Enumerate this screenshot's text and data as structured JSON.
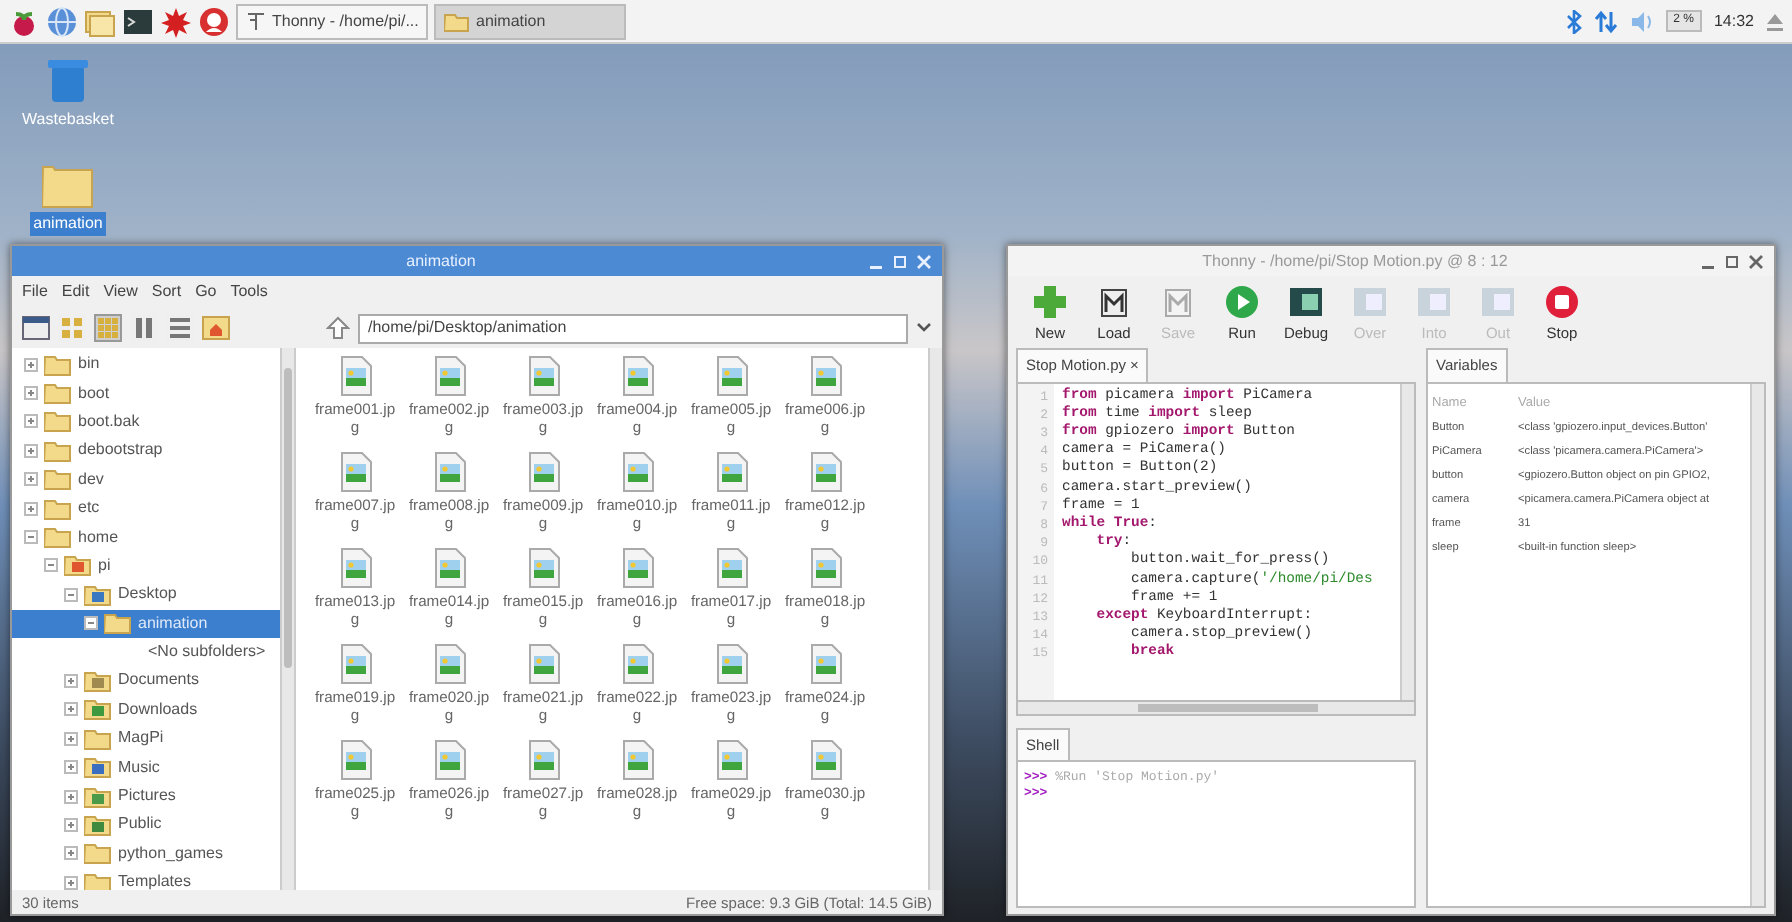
{
  "taskbar": {
    "tasks": [
      {
        "label": "Thonny - /home/pi/...",
        "kind": "thonny",
        "selected": false
      },
      {
        "label": "animation",
        "kind": "folder",
        "selected": true
      }
    ],
    "cpu": "2 %",
    "clock": "14:32"
  },
  "desktop_icons": [
    {
      "label": "Wastebasket",
      "kind": "trash",
      "selected": false
    },
    {
      "label": "animation",
      "kind": "folder",
      "selected": true
    }
  ],
  "file_manager": {
    "title": "animation",
    "menu": [
      "File",
      "Edit",
      "View",
      "Sort",
      "Go",
      "Tools"
    ],
    "view_modes": [
      {
        "selected": false
      },
      {
        "selected": true
      },
      {
        "selected": false
      },
      {
        "selected": false
      }
    ],
    "path": "/home/pi/Desktop/animation",
    "tree": [
      {
        "label": "bin",
        "kind": "folder",
        "expanded": false,
        "selected": false
      },
      {
        "label": "boot",
        "kind": "folder",
        "expanded": false,
        "selected": false
      },
      {
        "label": "boot.bak",
        "kind": "folder",
        "expanded": false,
        "selected": false
      },
      {
        "label": "debootstrap",
        "kind": "folder",
        "expanded": false,
        "selected": false
      },
      {
        "label": "dev",
        "kind": "folder",
        "expanded": false,
        "selected": false
      },
      {
        "label": "etc",
        "kind": "folder",
        "expanded": false,
        "selected": false
      },
      {
        "label": "home",
        "kind": "folder",
        "expanded": true,
        "selected": false,
        "children": [
          {
            "label": "pi",
            "kind": "home",
            "expanded": true,
            "selected": false,
            "children": [
              {
                "label": "Desktop",
                "kind": "desktop",
                "expanded": true,
                "selected": false,
                "children": [
                  {
                    "label": "animation",
                    "kind": "folder",
                    "expanded": true,
                    "selected": true,
                    "children": [
                      {
                        "label": "<No subfolders>",
                        "kind": "note"
                      }
                    ]
                  }
                ]
              },
              {
                "label": "Documents",
                "kind": "documents",
                "expanded": false,
                "selected": false
              },
              {
                "label": "Downloads",
                "kind": "downloads",
                "expanded": false,
                "selected": false
              },
              {
                "label": "MagPi",
                "kind": "folder",
                "expanded": false,
                "selected": false
              },
              {
                "label": "Music",
                "kind": "music",
                "expanded": false,
                "selected": false
              },
              {
                "label": "Pictures",
                "kind": "pictures",
                "expanded": false,
                "selected": false
              },
              {
                "label": "Public",
                "kind": "public",
                "expanded": false,
                "selected": false
              },
              {
                "label": "python_games",
                "kind": "folder",
                "expanded": false,
                "selected": false
              },
              {
                "label": "Templates",
                "kind": "folder",
                "expanded": false,
                "selected": false
              }
            ]
          }
        ]
      }
    ],
    "files": [
      "frame001.jpg",
      "frame002.jpg",
      "frame003.jpg",
      "frame004.jpg",
      "frame005.jpg",
      "frame006.jpg",
      "frame007.jpg",
      "frame008.jpg",
      "frame009.jpg",
      "frame010.jpg",
      "frame011.jpg",
      "frame012.jpg",
      "frame013.jpg",
      "frame014.jpg",
      "frame015.jpg",
      "frame016.jpg",
      "frame017.jpg",
      "frame018.jpg",
      "frame019.jpg",
      "frame020.jpg",
      "frame021.jpg",
      "frame022.jpg",
      "frame023.jpg",
      "frame024.jpg",
      "frame025.jpg",
      "frame026.jpg",
      "frame027.jpg",
      "frame028.jpg",
      "frame029.jpg",
      "frame030.jpg"
    ],
    "status_left": "30 items",
    "status_right": "Free space: 9.3 GiB (Total: 14.5 GiB)"
  },
  "thonny": {
    "title": "Thonny - /home/pi/Stop Motion.py @ 8 : 12",
    "toolbar": [
      {
        "label": "New",
        "kind": "new",
        "disabled": false
      },
      {
        "label": "Load",
        "kind": "load",
        "disabled": false
      },
      {
        "label": "Save",
        "kind": "save",
        "disabled": true
      },
      {
        "label": "Run",
        "kind": "run",
        "disabled": false
      },
      {
        "label": "Debug",
        "kind": "debug",
        "disabled": false
      },
      {
        "label": "Over",
        "kind": "over",
        "disabled": true
      },
      {
        "label": "Into",
        "kind": "into",
        "disabled": true
      },
      {
        "label": "Out",
        "kind": "out",
        "disabled": true
      },
      {
        "label": "Stop",
        "kind": "stop",
        "disabled": false
      }
    ],
    "editor_tab": {
      "label": "Stop Motion.py",
      "close": "×",
      "selected": true
    },
    "code": [
      {
        "number": "1",
        "segments": [
          {
            "kind": "keyword",
            "text": "from"
          },
          {
            "kind": "plain",
            "text": " picamera "
          },
          {
            "kind": "keyword",
            "text": "import"
          },
          {
            "kind": "plain",
            "text": " PiCamera"
          }
        ]
      },
      {
        "number": "2",
        "segments": [
          {
            "kind": "keyword",
            "text": "from"
          },
          {
            "kind": "plain",
            "text": " time "
          },
          {
            "kind": "keyword",
            "text": "import"
          },
          {
            "kind": "plain",
            "text": " sleep"
          }
        ]
      },
      {
        "number": "3",
        "segments": [
          {
            "kind": "keyword",
            "text": "from"
          },
          {
            "kind": "plain",
            "text": " gpiozero "
          },
          {
            "kind": "keyword",
            "text": "import"
          },
          {
            "kind": "plain",
            "text": " Button"
          }
        ]
      },
      {
        "number": "4",
        "segments": [
          {
            "kind": "plain",
            "text": "camera = PiCamera()"
          }
        ]
      },
      {
        "number": "5",
        "segments": [
          {
            "kind": "plain",
            "text": "button = Button(2)"
          }
        ]
      },
      {
        "number": "6",
        "segments": [
          {
            "kind": "plain",
            "text": "camera.start_preview()"
          }
        ]
      },
      {
        "number": "7",
        "segments": [
          {
            "kind": "plain",
            "text": "frame = 1"
          }
        ]
      },
      {
        "number": "8",
        "segments": [
          {
            "kind": "keyword",
            "text": "while True"
          },
          {
            "kind": "plain",
            "text": ":"
          }
        ]
      },
      {
        "number": "9",
        "segments": [
          {
            "kind": "keyword",
            "text": "    try"
          },
          {
            "kind": "plain",
            "text": ":"
          }
        ]
      },
      {
        "number": "10",
        "segments": [
          {
            "kind": "plain",
            "text": "        button.wait_for_press()"
          }
        ]
      },
      {
        "number": "11",
        "segments": [
          {
            "kind": "plain",
            "text": "        camera.capture("
          },
          {
            "kind": "string",
            "text": "'/home/pi/Des"
          }
        ]
      },
      {
        "number": "12",
        "segments": [
          {
            "kind": "plain",
            "text": "        frame += 1"
          }
        ]
      },
      {
        "number": "13",
        "segments": [
          {
            "kind": "keyword",
            "text": "    except"
          },
          {
            "kind": "plain",
            "text": " KeyboardInterrupt:"
          }
        ]
      },
      {
        "number": "14",
        "segments": [
          {
            "kind": "plain",
            "text": "        camera.stop_preview()"
          }
        ]
      },
      {
        "number": "15",
        "segments": [
          {
            "kind": "keyword",
            "text": "        break"
          }
        ]
      }
    ],
    "variables_tab": {
      "label": "Variables",
      "selected": true
    },
    "variables": {
      "columns": [
        "Name",
        "Value"
      ],
      "rows": [
        [
          "Button",
          "<class 'gpiozero.input_devices.Button'"
        ],
        [
          "PiCamera",
          "<class 'picamera.camera.PiCamera'>"
        ],
        [
          "button",
          "<gpiozero.Button object on pin GPIO2,"
        ],
        [
          "camera",
          "<picamera.camera.PiCamera object at"
        ],
        [
          "frame",
          "31"
        ],
        [
          "sleep",
          "<built-in function sleep>"
        ]
      ]
    },
    "shell_tab": {
      "label": "Shell",
      "selected": true
    },
    "shell": [
      [
        {
          "kind": "prompt",
          "text": ">>>"
        },
        {
          "kind": "command",
          "text": " %Run 'Stop Motion.py'"
        }
      ],
      [
        {
          "kind": "prompt",
          "text": ">>>"
        }
      ]
    ]
  }
}
